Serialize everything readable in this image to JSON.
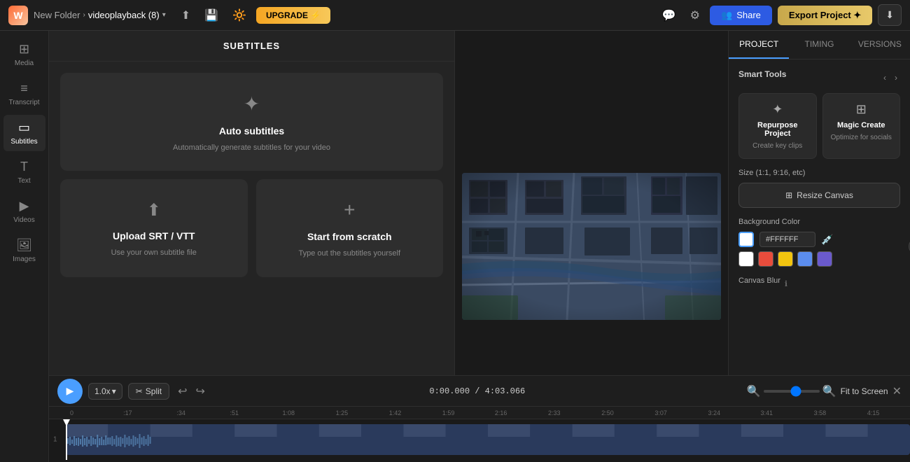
{
  "topbar": {
    "logo_text": "W",
    "folder_name": "New Folder",
    "separator": "›",
    "project_name": "videoplayback (8)",
    "upgrade_label": "UPGRADE ⚡",
    "share_label": "Share",
    "export_label": "Export Project ✦",
    "share_icon": "👥",
    "settings_icon": "⚙",
    "chat_icon": "💬",
    "brightness_icon": "🔆",
    "share_icon2": "⬆",
    "save_icon": "💾"
  },
  "sidebar": {
    "items": [
      {
        "id": "media",
        "icon": "⊞",
        "label": "Media"
      },
      {
        "id": "transcript",
        "icon": "≡",
        "label": "Transcript"
      },
      {
        "id": "subtitles",
        "icon": "▭",
        "label": "Subtitles",
        "active": true
      },
      {
        "id": "text",
        "icon": "T",
        "label": "Text"
      },
      {
        "id": "videos",
        "icon": "▶",
        "label": "Videos"
      },
      {
        "id": "images",
        "icon": "🖼",
        "label": "Images"
      }
    ]
  },
  "subtitles_panel": {
    "header": "SUBTITLES",
    "cards": [
      {
        "id": "auto",
        "icon": "✦",
        "title": "Auto subtitles",
        "description": "Automatically generate subtitles for your video",
        "size": "large"
      },
      {
        "id": "upload",
        "icon": "⬆",
        "title": "Upload SRT / VTT",
        "description": "Use your own subtitle file",
        "size": "small"
      },
      {
        "id": "scratch",
        "icon": "+",
        "title": "Start from scratch",
        "description": "Type out the subtitles yourself",
        "size": "small"
      }
    ]
  },
  "right_panel": {
    "tabs": [
      {
        "id": "project",
        "label": "PROJECT",
        "active": true
      },
      {
        "id": "timing",
        "label": "TIMING",
        "active": false
      },
      {
        "id": "versions",
        "label": "VERSIONS",
        "active": false
      }
    ],
    "smart_tools_title": "Smart Tools",
    "tools": [
      {
        "id": "repurpose",
        "icon": "✦",
        "title": "Repurpose Project",
        "description": "Create key clips"
      },
      {
        "id": "magic_create",
        "icon": "⊞",
        "title": "Magic Create",
        "description": "Optimize for socials"
      }
    ],
    "size_section_label": "Size (1:1, 9:16, etc)",
    "resize_canvas_label": "Resize Canvas",
    "resize_icon": "⊞",
    "bg_color_section_label": "Background Color",
    "bg_color_hex": "#FFFFFF",
    "color_presets": [
      {
        "id": "white",
        "color": "#FFFFFF"
      },
      {
        "id": "red",
        "color": "#e74c3c"
      },
      {
        "id": "yellow",
        "color": "#f1c40f"
      },
      {
        "id": "blue-light",
        "color": "#5b8dee"
      }
    ],
    "canvas_blur_label": "Canvas Blur",
    "canvas_blur_icon": "ℹ"
  },
  "timeline": {
    "play_label": "▶",
    "speed": "1.0x",
    "split_label": "Split",
    "split_icon": "✂",
    "undo_icon": "↩",
    "redo_icon": "↪",
    "current_time": "0:00.000",
    "total_time": "4:03.066",
    "fit_to_screen": "Fit to Screen",
    "close_icon": "✕",
    "ruler_marks": [
      "0",
      ":17",
      ":34",
      ":51",
      "1:08",
      "1:25",
      "1:42",
      "1:59",
      "2:16",
      "2:33",
      "2:50",
      "3:07",
      "3:24",
      "3:41",
      "3:58",
      "4:15"
    ],
    "track_number": "1"
  }
}
